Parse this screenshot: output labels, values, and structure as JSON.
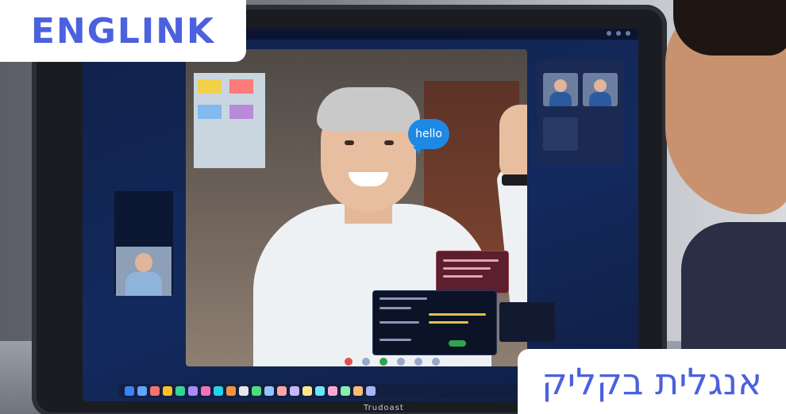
{
  "brand": {
    "logo_text": "ENGLINK",
    "tagline": "אנגלית בקליק",
    "accent_color": "#4b61dd"
  },
  "video_call": {
    "chat_bubble_text": "hello",
    "laptop_brand": "Trudoast"
  }
}
